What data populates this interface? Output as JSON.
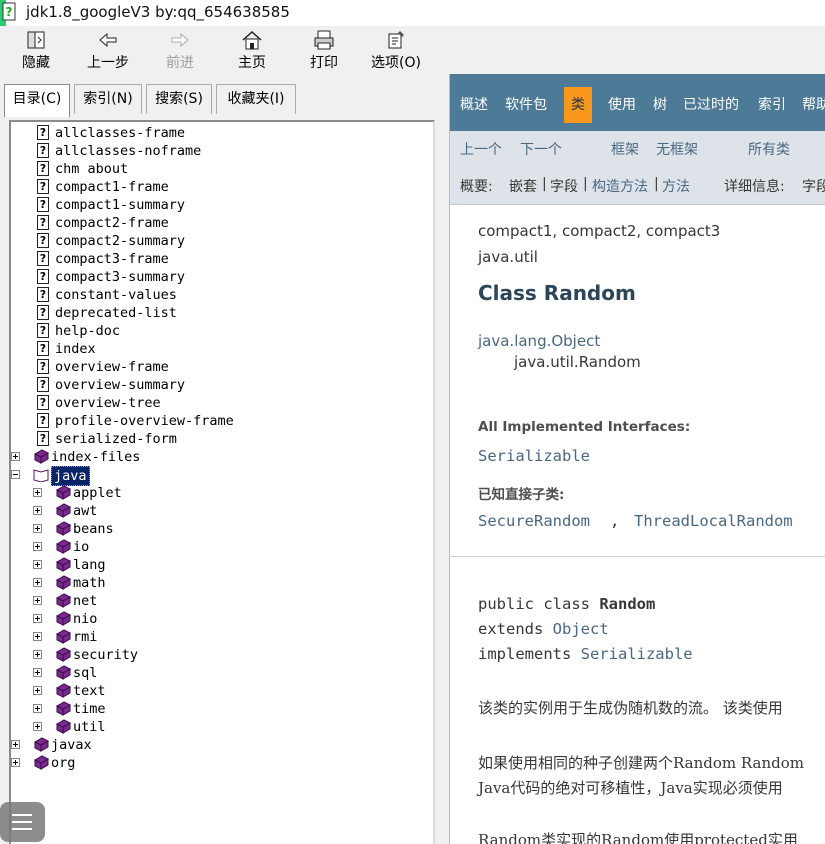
{
  "window": {
    "title": "jdk1.8_googleV3 by:qq_654638585"
  },
  "toolbar": {
    "buttons": [
      {
        "label": "隐藏",
        "icon": "hide-icon"
      },
      {
        "label": "上一步",
        "icon": "back-arrow-icon"
      },
      {
        "label": "前进",
        "icon": "forward-arrow-icon"
      },
      {
        "label": "主页",
        "icon": "home-icon"
      },
      {
        "label": "打印",
        "icon": "print-icon"
      },
      {
        "label": "选项(O)",
        "icon": "options-icon"
      }
    ]
  },
  "tabs": [
    {
      "label": "目录(C)"
    },
    {
      "label": "索引(N)"
    },
    {
      "label": "搜索(S)"
    },
    {
      "label": "收藏夹(I)"
    }
  ],
  "tree": {
    "pages": [
      "allclasses-frame",
      "allclasses-noframe",
      "chm about",
      "compact1-frame",
      "compact1-summary",
      "compact2-frame",
      "compact2-summary",
      "compact3-frame",
      "compact3-summary",
      "constant-values",
      "deprecated-list",
      "help-doc",
      "index",
      "overview-frame",
      "overview-summary",
      "overview-tree",
      "profile-overview-frame",
      "serialized-form"
    ],
    "index_files": "index-files",
    "java": "java",
    "java_children": [
      "applet",
      "awt",
      "beans",
      "io",
      "lang",
      "math",
      "net",
      "nio",
      "rmi",
      "security",
      "sql",
      "text",
      "time",
      "util"
    ],
    "javax": "javax",
    "org": "org"
  },
  "nav": {
    "items": [
      "概述",
      "软件包",
      "类",
      "使用",
      "树",
      "已过时的",
      "索引",
      "帮助"
    ],
    "active_index": 2,
    "prev_class": "上一个",
    "next_class": "下一个",
    "frames": "框架",
    "no_frames": "无框架",
    "all_classes": "所有类",
    "summary_label": "概要:",
    "summary_links": {
      "nested": "嵌套",
      "sep1": "|",
      "field": "字段",
      "sep2": "|",
      "constr": "构造方法",
      "sep3": "|",
      "method": "方法"
    },
    "detail_label": "详细信息:",
    "detail_field": "字段"
  },
  "doc": {
    "profiles": "compact1, compact2, compact3",
    "package": "java.util",
    "class_title": "Class Random",
    "super_class": "java.lang.Object",
    "this_class": "java.util.Random",
    "impl_interfaces_label": "All Implemented Interfaces:",
    "impl_interfaces": "Serializable",
    "subclasses_label": "已知直接子类:",
    "subclass1": "SecureRandom",
    "subclass_sep": ",",
    "subclass2": "ThreadLocalRandom",
    "decl_public_class": "public class ",
    "decl_name": "Random",
    "decl_extends": "extends ",
    "decl_extends_type": "Object",
    "decl_implements": "implements ",
    "decl_implements_type": "Serializable",
    "para1": "该类的实例用于生成伪随机数的流。 该类使用",
    "para2_line1": "如果使用相同的种子创建两个Random Random",
    "para2_line2": "Java代码的绝对可移植性，Java实现必须使用",
    "para3": "Random类实现的Random使用protected实用"
  },
  "colors": {
    "navbar": "#4d7a97",
    "nav_active": "#f8981d",
    "subnav": "#dee3e9",
    "link": "#4a6782"
  }
}
